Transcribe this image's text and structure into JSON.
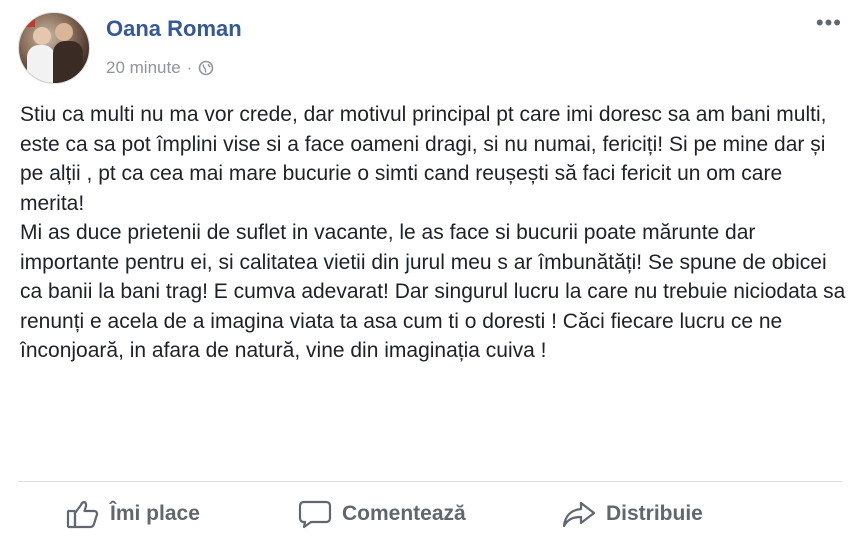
{
  "post": {
    "author": "Oana Roman",
    "time": "20 minute",
    "separator": "·",
    "privacy_icon": "globe-icon",
    "menu_icon": "more-options-icon",
    "more_glyph": "•••",
    "paragraphs": [
      "Stiu ca multi nu ma vor crede, dar motivul principal pt care imi doresc sa am bani multi, este ca sa pot împlini vise si a face oameni dragi, si nu numai, fericiți! Si pe mine dar și pe alții , pt ca cea mai mare bucurie o simti cand reușești să faci fericit un om care merita!",
      "Mi as duce prietenii de suflet in vacante, le as face si bucurii poate mărunte dar importante pentru ei, si calitatea vietii din jurul meu s ar îmbunătăți! Se spune de obicei ca banii la bani trag! E cumva adevarat! Dar singurul lucru la care nu trebuie niciodata sa renunți e acela de a imagina viata ta asa cum ti o doresti ! Căci fiecare lucru ce ne înconjoară, in afara de natură, vine din imaginația cuiva !"
    ]
  },
  "actions": {
    "like": {
      "label": "Îmi place",
      "icon": "thumbs-up-icon"
    },
    "comment": {
      "label": "Comentează",
      "icon": "comment-icon"
    },
    "share": {
      "label": "Distribuie",
      "icon": "share-icon"
    }
  },
  "colors": {
    "author": "#365899",
    "meta": "#90949c",
    "text": "#1d2129",
    "action": "#606770",
    "divider": "#dddfe2"
  }
}
